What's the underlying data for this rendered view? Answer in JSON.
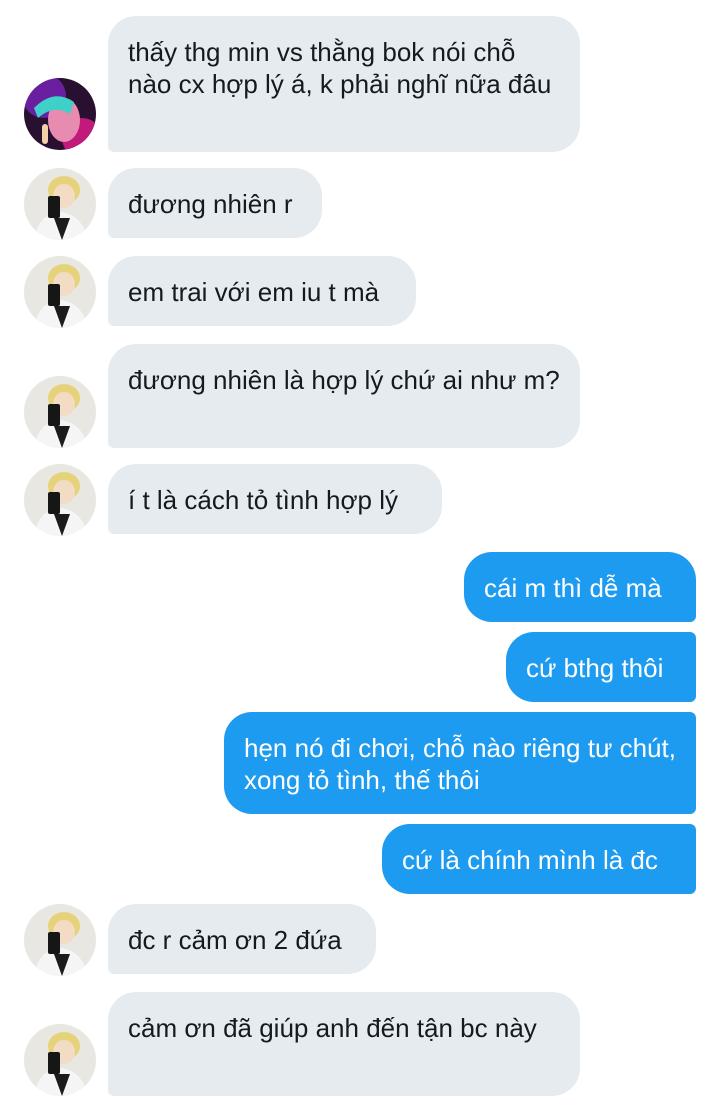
{
  "colors": {
    "incoming_bubble": "#e6ebf0",
    "outgoing_bubble": "#1d9bf0",
    "incoming_text": "#151a1f",
    "outgoing_text": "#ffffff"
  },
  "avatars": {
    "sender_a": "neon-portrait-avatar",
    "sender_b": "mirror-selfie-avatar"
  },
  "messages": [
    {
      "direction": "incoming",
      "sender": "sender_a",
      "text": "thấy thg min vs thằng bok nói chỗ nào cx hợp lý á, k phải nghĩ nữa đâu"
    },
    {
      "direction": "incoming",
      "sender": "sender_b",
      "text": "đương nhiên r"
    },
    {
      "direction": "incoming",
      "sender": "sender_b",
      "text": "em trai với em iu t mà"
    },
    {
      "direction": "incoming",
      "sender": "sender_b",
      "text": "đương nhiên là hợp lý chứ ai như m?"
    },
    {
      "direction": "incoming",
      "sender": "sender_b",
      "text": "í t là cách tỏ tình hợp lý"
    },
    {
      "direction": "outgoing",
      "text": "cái m thì dễ mà"
    },
    {
      "direction": "outgoing",
      "text": "cứ bthg thôi"
    },
    {
      "direction": "outgoing",
      "text": "hẹn nó đi chơi, chỗ nào riêng tư chút, xong tỏ tình, thế thôi"
    },
    {
      "direction": "outgoing",
      "text": "cứ là chính mình là đc"
    },
    {
      "direction": "incoming",
      "sender": "sender_b",
      "text": "đc r cảm ơn 2 đứa"
    },
    {
      "direction": "incoming",
      "sender": "sender_b",
      "text": "cảm ơn đã giúp anh đến tận bc này"
    }
  ]
}
